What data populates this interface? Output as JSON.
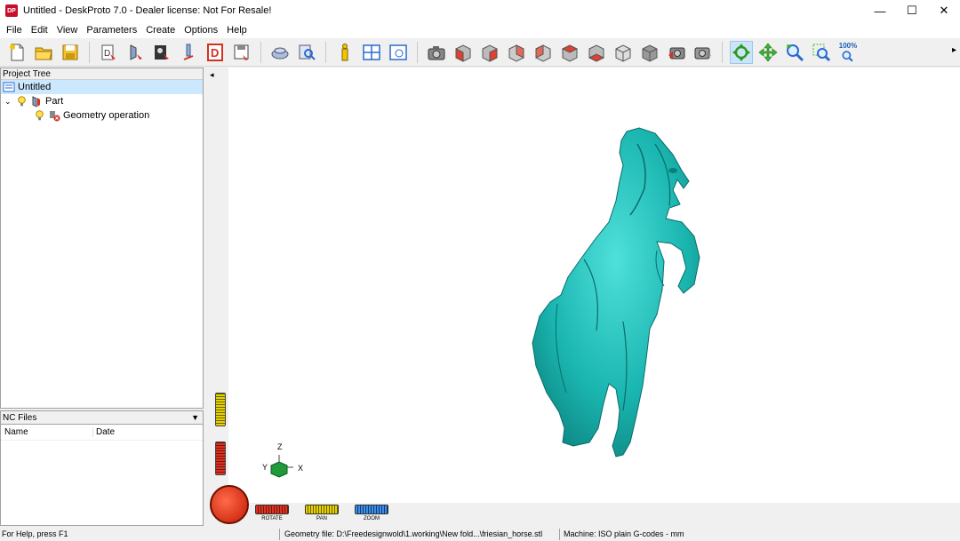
{
  "window": {
    "title": "Untitled - DeskProto 7.0 - Dealer license: Not For Resale!",
    "logo_text": "DP",
    "controls": [
      "—",
      "☐",
      "✕"
    ]
  },
  "menu": [
    "File",
    "Edit",
    "View",
    "Parameters",
    "Create",
    "Options",
    "Help"
  ],
  "toolbar": {
    "zoom_label": "100%"
  },
  "project_tree": {
    "header": "Project Tree",
    "root": "Untitled",
    "part": "Part",
    "operation": "Geometry operation"
  },
  "nc_files": {
    "header": "NC Files",
    "columns": [
      "Name",
      "Date"
    ]
  },
  "viewport": {
    "axes": {
      "z": "Z",
      "y": "Y",
      "x": "X"
    },
    "controls": {
      "rotate": "ROTATE",
      "pan": "PAN",
      "zoom": "ZOOM"
    },
    "model_color": "#1ab5b0"
  },
  "status": {
    "help": "For Help, press F1",
    "geometry_file": "Geometry file: D:\\Freedesignwold\\1.working\\New fold...\\friesian_horse.stl",
    "machine": "Machine: ISO plain G-codes - mm"
  }
}
